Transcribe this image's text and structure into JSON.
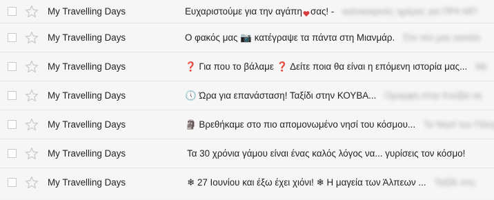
{
  "rows": [
    {
      "sender": "My Travelling Days",
      "subject_pre": "Ευχαριστούμε για την αγάπη",
      "subject_post": "σας! -",
      "snippet": "καλοκαιρινές ημέρες για ΠΡΑ ΜΠ"
    },
    {
      "sender": "My Travelling Days",
      "icon": "camera-icon",
      "subject": "Ο φακός μας 📷 κατέγραψε τα πάντα στη Μιανμάρ.",
      "snippet": "Στο νέο μας κανάλι"
    },
    {
      "sender": "My Travelling Days",
      "subject": "❓ Για που το βάλαμε ❓ Δείτε ποια θα είναι η επόμενη ιστορία μας...",
      "snippet": "Με"
    },
    {
      "sender": "My Travelling Days",
      "subject": "🕔 Ώρα για επανάσταση! Ταξίδι στην ΚΟΥΒΑ...",
      "snippet": "Ομορφη στην Κούβα σε"
    },
    {
      "sender": "My Travelling Days",
      "subject": "🗿 Βρεθήκαμε στο πιο απομονωμένο νησί του κόσμου...",
      "snippet": "Το Νησί του Πάσχα"
    },
    {
      "sender": "My Travelling Days",
      "subject": "Τα 30 χρόνια γάμου είναι ένας καλός λόγος να... γυρίσεις τον κόσμο!",
      "snippet": ""
    },
    {
      "sender": "My Travelling Days",
      "subject": "❄ 27 Ιουνίου και έξω έχει χιόνι! ❄ Η μαγεία των Άλπεων ...",
      "snippet": "Ταξίδι στη"
    }
  ],
  "colors": {
    "row_bg": "#f6f6f6",
    "divider": "#e6e6e6",
    "text": "#222222",
    "snippet": "#888888",
    "heart": "#d93a3a"
  }
}
